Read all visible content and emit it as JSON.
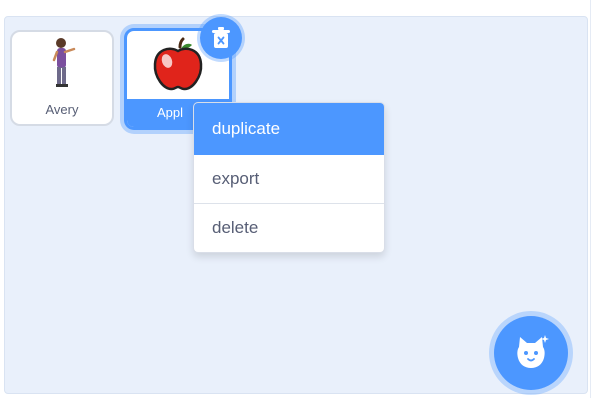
{
  "sprite_list": [
    {
      "name": "Avery",
      "icon": "person-sprite-icon",
      "selected": false
    },
    {
      "name": "Apple",
      "icon": "apple-sprite-icon",
      "selected": true,
      "visible_label": "Appl"
    }
  ],
  "context_menu": {
    "items": [
      {
        "label": "duplicate",
        "highlighted": true
      },
      {
        "label": "export",
        "highlighted": false
      },
      {
        "label": "delete",
        "highlighted": false
      }
    ]
  },
  "icons": {
    "delete_badge": "trash-icon",
    "choose_sprite": "cat-icon"
  },
  "colors": {
    "accent": "#4c97ff",
    "pane_background": "#e9f0fb",
    "text": "#575e75",
    "apple_red": "#e0241b"
  }
}
